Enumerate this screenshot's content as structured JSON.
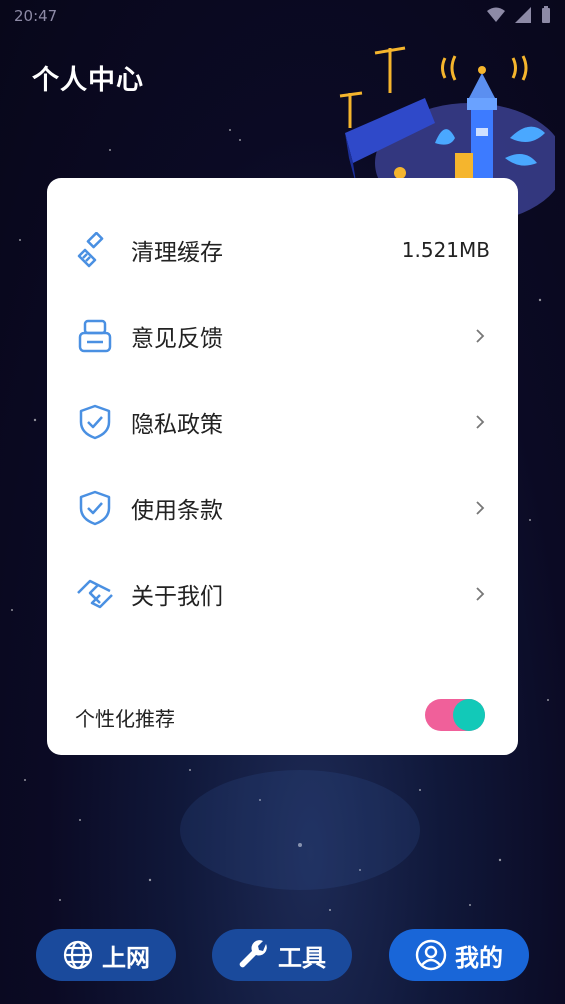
{
  "status_bar": {
    "time": "20:47"
  },
  "header": {
    "title": "个人中心"
  },
  "menu": {
    "items": [
      {
        "label": "清理缓存",
        "value": "1.521MB",
        "icon": "broom-icon"
      },
      {
        "label": "意见反馈",
        "icon": "feedback-icon"
      },
      {
        "label": "隐私政策",
        "icon": "shield-check-icon"
      },
      {
        "label": "使用条款",
        "icon": "shield-check-icon"
      },
      {
        "label": "关于我们",
        "icon": "handshake-icon"
      }
    ],
    "personalization": {
      "label": "个性化推荐",
      "enabled": true
    }
  },
  "bottom_nav": {
    "items": [
      {
        "label": "上网",
        "icon": "globe-icon",
        "active": false
      },
      {
        "label": "工具",
        "icon": "wrench-icon",
        "active": false
      },
      {
        "label": "我的",
        "icon": "user-icon",
        "active": true
      }
    ]
  },
  "colors": {
    "accent": "#1966d8",
    "nav_button": "#1a4a9c",
    "icon_blue": "#4a90e2",
    "toggle_track": "#f0609a",
    "toggle_knob": "#12c9b8"
  }
}
